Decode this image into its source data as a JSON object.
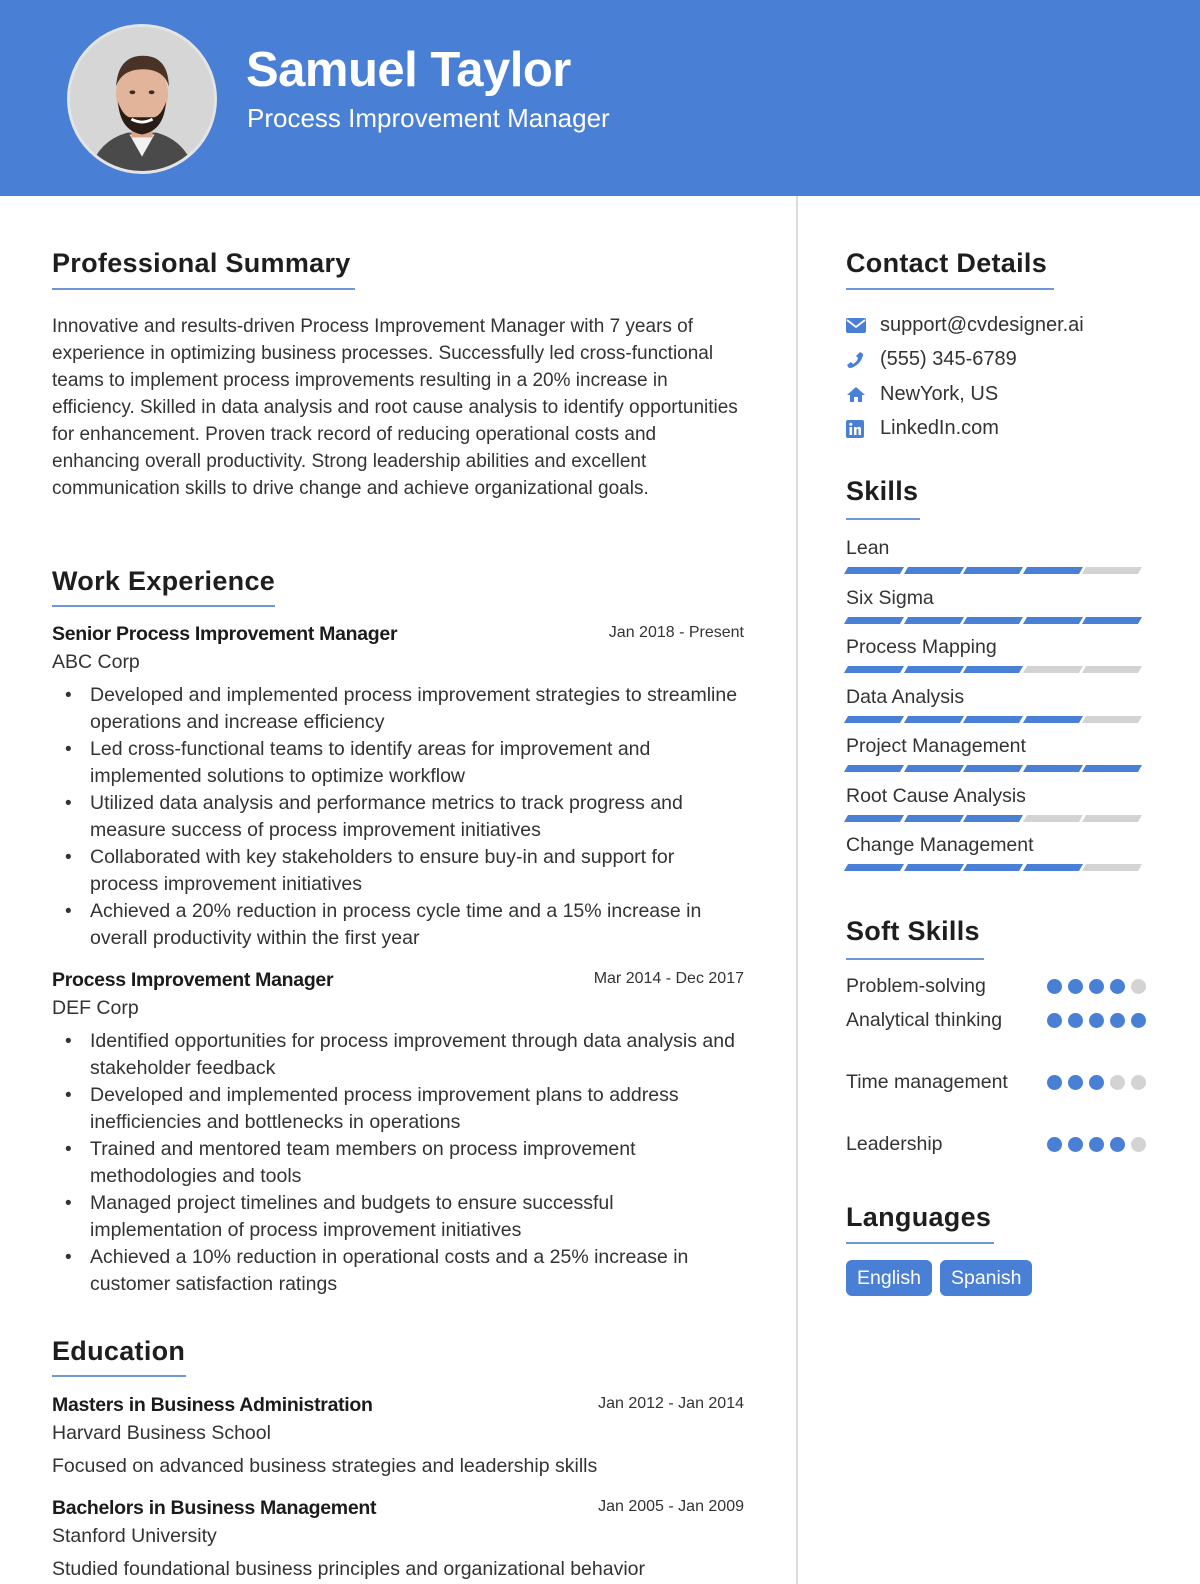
{
  "header": {
    "name": "Samuel Taylor",
    "title": "Process Improvement Manager",
    "accent_color": "#4a7fd6"
  },
  "sections": {
    "summary": "Professional Summary",
    "experience": "Work Experience",
    "education": "Education",
    "contact": "Contact Details",
    "skills": "Skills",
    "soft_skills": "Soft Skills",
    "languages": "Languages"
  },
  "summary": "Innovative and results-driven Process Improvement Manager with 7 years of experience in optimizing business processes. Successfully led cross-functional teams to implement process improvements resulting in a 20% increase in efficiency. Skilled in data analysis and root cause analysis to identify opportunities for enhancement. Proven track record of reducing operational costs and enhancing overall productivity. Strong leadership abilities and excellent communication skills to drive change and achieve organizational goals.",
  "experience": [
    {
      "title": "Senior Process Improvement Manager",
      "company": "ABC Corp",
      "dates": "Jan 2018 - Present",
      "bullets": [
        "Developed and implemented process improvement strategies to streamline operations and increase efficiency",
        "Led cross-functional teams to identify areas for improvement and implemented solutions to optimize workflow",
        "Utilized data analysis and performance metrics to track progress and measure success of process improvement initiatives",
        "Collaborated with key stakeholders to ensure buy-in and support for process improvement initiatives",
        "Achieved a 20% reduction in process cycle time and a 15% increase in overall productivity within the first year"
      ]
    },
    {
      "title": "Process Improvement Manager",
      "company": "DEF Corp",
      "dates": "Mar 2014 - Dec 2017",
      "bullets": [
        "Identified opportunities for process improvement through data analysis and stakeholder feedback",
        "Developed and implemented process improvement plans to address inefficiencies and bottlenecks in operations",
        "Trained and mentored team members on process improvement methodologies and tools",
        "Managed project timelines and budgets to ensure successful implementation of process improvement initiatives",
        "Achieved a 10% reduction in operational costs and a 25% increase in customer satisfaction ratings"
      ]
    }
  ],
  "education": [
    {
      "degree": "Masters in Business Administration",
      "school": "Harvard Business School",
      "dates": "Jan 2012 - Jan 2014",
      "description": "Focused on advanced business strategies and leadership skills"
    },
    {
      "degree": "Bachelors in Business Management",
      "school": "Stanford University",
      "dates": "Jan 2005 - Jan 2009",
      "description": "Studied foundational business principles and organizational behavior"
    }
  ],
  "contact": [
    {
      "icon": "envelope-icon",
      "text": "support@cvdesigner.ai"
    },
    {
      "icon": "phone-icon",
      "text": "(555) 345-6789"
    },
    {
      "icon": "home-icon",
      "text": "NewYork, US"
    },
    {
      "icon": "linkedin-icon",
      "text": "LinkedIn.com"
    }
  ],
  "skills": [
    {
      "name": "Lean",
      "level": 4,
      "max": 5
    },
    {
      "name": "Six Sigma",
      "level": 5,
      "max": 5
    },
    {
      "name": "Process Mapping",
      "level": 3,
      "max": 5
    },
    {
      "name": "Data Analysis",
      "level": 4,
      "max": 5
    },
    {
      "name": "Project Management",
      "level": 5,
      "max": 5
    },
    {
      "name": "Root Cause Analysis",
      "level": 3,
      "max": 5
    },
    {
      "name": "Change Management",
      "level": 4,
      "max": 5
    }
  ],
  "soft_skills": [
    {
      "name": "Problem-solving",
      "level": 4,
      "max": 5
    },
    {
      "name": "Analytical thinking",
      "level": 5,
      "max": 5
    },
    {
      "name": "Time management",
      "level": 3,
      "max": 5
    },
    {
      "name": "Leadership",
      "level": 4,
      "max": 5
    }
  ],
  "languages": [
    "English",
    "Spanish"
  ]
}
